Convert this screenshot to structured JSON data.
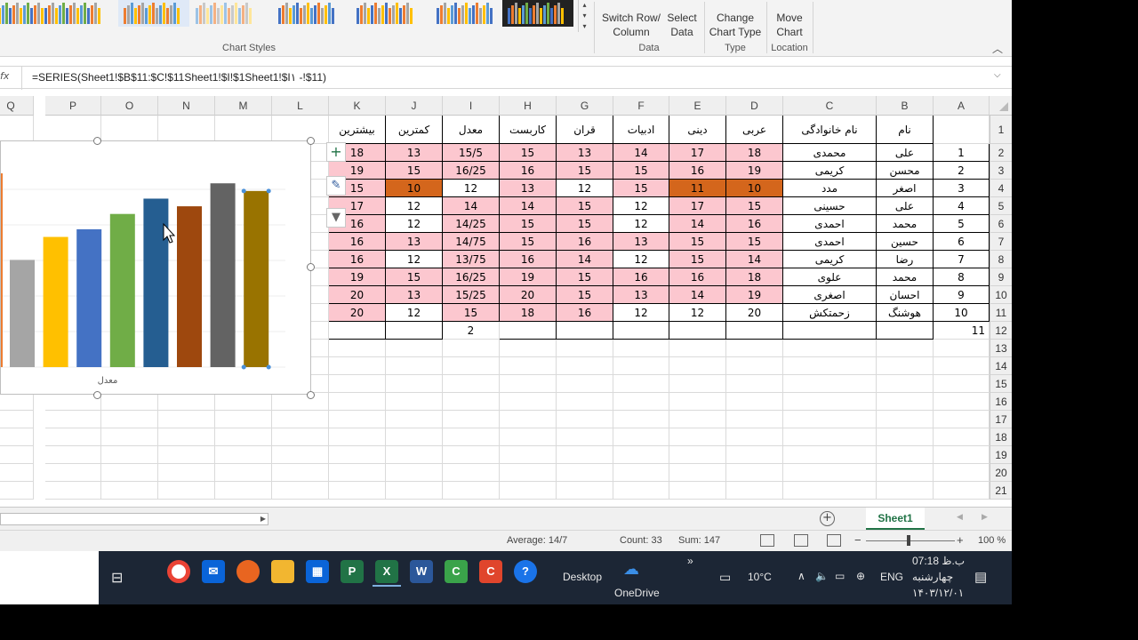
{
  "ribbon": {
    "group_chart_styles": "Chart Styles",
    "switch_row_col": [
      "Switch Row/",
      "Column"
    ],
    "select_data": [
      "Select",
      "Data"
    ],
    "group_data": "Data",
    "change_chart_type": [
      "Change",
      "Chart Type"
    ],
    "group_type": "Type",
    "move_chart": [
      "Move",
      "Chart"
    ],
    "group_location": "Location"
  },
  "formula_bar": {
    "fx_label": "fx",
    "formula": "=SERIES(Sheet1!$B$11:$C!$11Sheet1!$I!$1Sheet1!$I١ -!$11)"
  },
  "columns": [
    "Q",
    "P",
    "O",
    "N",
    "M",
    "L",
    "K",
    "J",
    "I",
    "H",
    "G",
    "F",
    "E",
    "D",
    "C",
    "B",
    "A"
  ],
  "rows": [
    "1",
    "2",
    "3",
    "4",
    "5",
    "6",
    "7",
    "8",
    "9",
    "10",
    "11",
    "12",
    "13",
    "14",
    "15",
    "16",
    "17",
    "18",
    "19",
    "20",
    "21"
  ],
  "table": {
    "headers": [
      "بیشترین",
      "کمترین",
      "معدل",
      "کاربست",
      "قران",
      "ادبیات",
      "دینی",
      "عربی",
      "نام خانوادگی",
      "نام"
    ],
    "rows": [
      {
        "k": "18",
        "j": "13",
        "i": "15/5",
        "h": "15",
        "g": "13",
        "f": "14",
        "e": "17",
        "d": "18",
        "c": "محمدی",
        "b": "علی",
        "a": "1"
      },
      {
        "k": "19",
        "j": "15",
        "i": "16/25",
        "h": "16",
        "g": "15",
        "f": "15",
        "e": "16",
        "d": "19",
        "c": "کریمی",
        "b": "محسن",
        "a": "2"
      },
      {
        "k": "15",
        "j": "10",
        "i": "12",
        "h": "13",
        "g": "12",
        "f": "15",
        "e": "11",
        "d": "10",
        "c": "مدد",
        "b": "اصغر",
        "a": "3"
      },
      {
        "k": "17",
        "j": "12",
        "i": "14",
        "h": "14",
        "g": "15",
        "f": "12",
        "e": "17",
        "d": "15",
        "c": "حسینی",
        "b": "علی",
        "a": "4"
      },
      {
        "k": "16",
        "j": "12",
        "i": "14/25",
        "h": "15",
        "g": "15",
        "f": "12",
        "e": "14",
        "d": "16",
        "c": "احمدی",
        "b": "محمد",
        "a": "5"
      },
      {
        "k": "16",
        "j": "13",
        "i": "14/75",
        "h": "15",
        "g": "16",
        "f": "13",
        "e": "15",
        "d": "15",
        "c": "احمدی",
        "b": "حسین",
        "a": "6"
      },
      {
        "k": "16",
        "j": "12",
        "i": "13/75",
        "h": "16",
        "g": "14",
        "f": "12",
        "e": "15",
        "d": "14",
        "c": "کریمی",
        "b": "رضا",
        "a": "7"
      },
      {
        "k": "19",
        "j": "15",
        "i": "16/25",
        "h": "19",
        "g": "15",
        "f": "16",
        "e": "16",
        "d": "18",
        "c": "علوی",
        "b": "محمد",
        "a": "8"
      },
      {
        "k": "20",
        "j": "13",
        "i": "15/25",
        "h": "20",
        "g": "15",
        "f": "13",
        "e": "14",
        "d": "19",
        "c": "اصغری",
        "b": "احسان",
        "a": "9"
      },
      {
        "k": "20",
        "j": "12",
        "i": "15",
        "h": "18",
        "g": "16",
        "f": "12",
        "e": "12",
        "d": "20",
        "c": "زحمتکش",
        "b": "هوشنگ",
        "a": "10"
      }
    ],
    "row12": {
      "i": "2",
      "a": "11"
    }
  },
  "chart": {
    "xlabel": "معدل"
  },
  "chart_data": {
    "type": "bar",
    "values": [
      16,
      17.5,
      18,
      19,
      20,
      19.5,
      21,
      20.5,
      20.5
    ],
    "ylim": [
      9,
      22
    ],
    "colors": [
      "#a5a5a5",
      "#ffc000",
      "#4472c4",
      "#70ad47",
      "#255e91",
      "#9e480e",
      "#636363",
      "#997300",
      "#997300"
    ],
    "xlabel": "معدل"
  },
  "sheet": {
    "tab_name": "Sheet1"
  },
  "status": {
    "average": "Average: 14/7",
    "count": "Count: 33",
    "sum": "Sum: 147",
    "zoom": "100 %"
  },
  "taskbar": {
    "desktop": "Desktop",
    "onedrive": "OneDrive",
    "temp": "10°C",
    "lang": "ENG",
    "time": "07:18 ب.ظ",
    "day": "چهارشنبه",
    "date": "۱۴۰۳/۱۲/۰۱",
    "chevron": "»"
  }
}
